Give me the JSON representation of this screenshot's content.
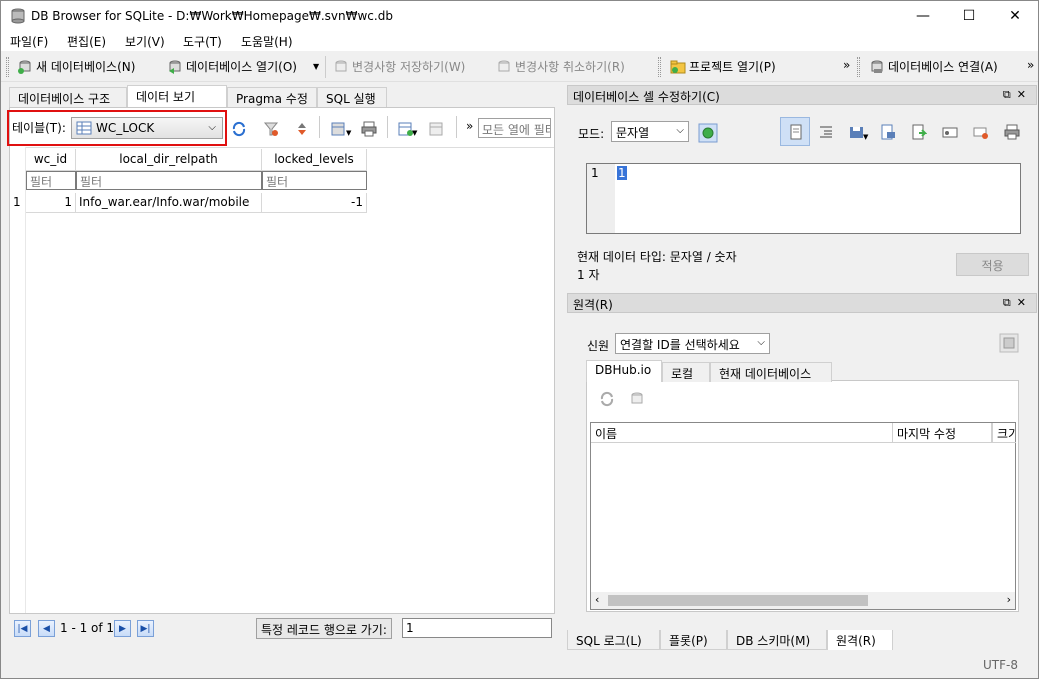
{
  "window": {
    "title": "DB Browser for SQLite - D:₩Work₩Homepage₩.svn₩wc.db",
    "min": "—",
    "max": "☐",
    "close": "✕"
  },
  "menu": [
    "파일(F)",
    "편집(E)",
    "보기(V)",
    "도구(T)",
    "도움말(H)"
  ],
  "toolbar": {
    "new_db": "새 데이터베이스(N)",
    "open_db": "데이터베이스 열기(O)",
    "write_changes": "변경사항 저장하기(W)",
    "revert_changes": "변경사항 취소하기(R)",
    "open_project": "프로젝트 열기(P)",
    "attach_db": "데이터베이스 연결(A)",
    "more": "»"
  },
  "main_tabs": [
    "데이터베이스 구조",
    "데이터 보기",
    "Pragma 수정",
    "SQL 실행"
  ],
  "browse": {
    "table_label": "테이블(T):",
    "table_value": "WC_LOCK",
    "filter_all_placeholder": "모든 열에 필터",
    "more": "»",
    "columns": [
      "wc_id",
      "local_dir_relpath",
      "locked_levels"
    ],
    "filter_placeholder": "필터",
    "rows": [
      {
        "num": "1",
        "cells": [
          "1",
          "Info_war.ear/Info.war/mobile",
          "-1"
        ]
      }
    ],
    "nav_text": "1 - 1 of 1",
    "goto_label": "특정 레코드 행으로 가기:",
    "goto_value": "1"
  },
  "edit_cell": {
    "title": "데이터베이스 셀 수정하기(C)",
    "mode_label": "모드:",
    "mode_value": "문자열",
    "line_number": "1",
    "content": "1",
    "type_info": "현재 데이터 타입: 문자열 / 숫자",
    "size_info": "1 자",
    "apply": "적용"
  },
  "remote": {
    "title": "원격(R)",
    "identity_label": "신원",
    "identity_value": "연결할 ID를 선택하세요",
    "tabs": [
      "DBHub.io",
      "로컬",
      "현재 데이터베이스"
    ],
    "columns": [
      "이름",
      "마지막 수정",
      "크기"
    ]
  },
  "bottom_tabs": [
    "SQL 로그(L)",
    "플롯(P)",
    "DB 스키마(M)",
    "원격(R)"
  ],
  "status": {
    "encoding": "UTF-8"
  },
  "dock_buttons": {
    "float": "⧉",
    "close": "✕"
  },
  "colors": {
    "highlight": "#e01010",
    "selection": "#3874d8"
  }
}
